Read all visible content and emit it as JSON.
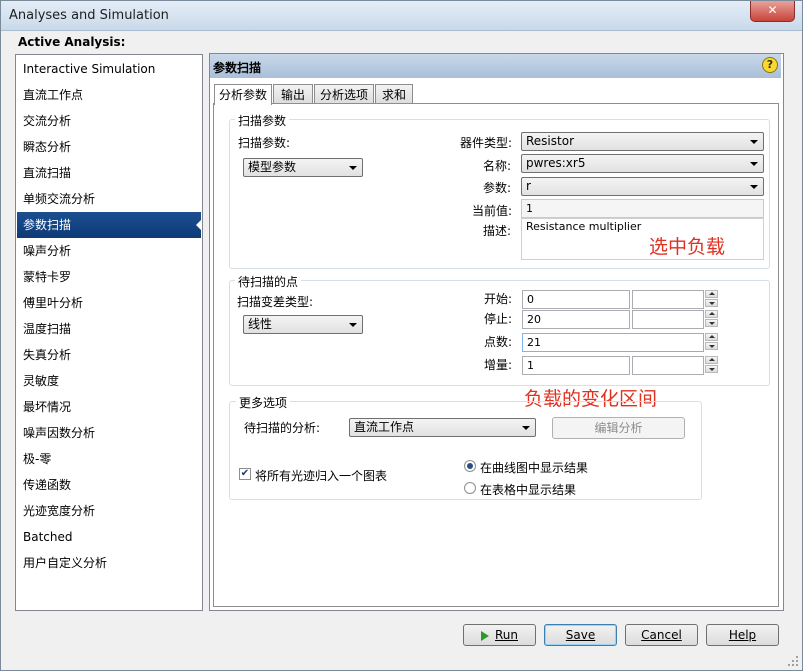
{
  "window": {
    "title": "Analyses and Simulation",
    "close_glyph": "✕"
  },
  "sidebar": {
    "header": "Active Analysis:",
    "selected_index": 6,
    "items": [
      "Interactive Simulation",
      "直流工作点",
      "交流分析",
      "瞬态分析",
      "直流扫描",
      "单频交流分析",
      "参数扫描",
      "噪声分析",
      "蒙特卡罗",
      "傅里叶分析",
      "温度扫描",
      "失真分析",
      "灵敏度",
      "最坏情况",
      "噪声因数分析",
      "极-零",
      "传递函数",
      "光迹宽度分析",
      "Batched",
      "用户自定义分析"
    ]
  },
  "panel": {
    "title": "参数扫描",
    "help_glyph": "?",
    "tabs": [
      "分析参数",
      "输出",
      "分析选项",
      "求和"
    ],
    "active_tab": 0
  },
  "sweep_params": {
    "group_title": "扫描参数",
    "sweep_param_label": "扫描参数:",
    "sweep_param_value": "模型参数",
    "device_type_label": "器件类型:",
    "device_type_value": "Resistor",
    "name_label": "名称:",
    "name_value": "pwres:xr5",
    "param_label": "参数:",
    "param_value": "r",
    "current_value_label": "当前值:",
    "current_value": "1",
    "description_label": "描述:",
    "description_value": "Resistance multiplier"
  },
  "points": {
    "group_title": "待扫描的点",
    "variation_type_label": "扫描变差类型:",
    "variation_type_value": "线性",
    "start_label": "开始:",
    "start_value": "0",
    "stop_label": "停止:",
    "stop_value": "20",
    "points_label": "点数:",
    "points_value": "21",
    "increment_label": "增量:",
    "increment_value": "1"
  },
  "more": {
    "group_title": "更多选项",
    "analysis_label": "待扫描的分析:",
    "analysis_value": "直流工作点",
    "edit_button": "编辑分析",
    "group_traces_label": "将所有光迹归入一个图表",
    "group_traces_checked": true,
    "check_glyph": "✔",
    "radio_graph_label": "在曲线图中显示结果",
    "radio_table_label": "在表格中显示结果",
    "radio_selected": "graph"
  },
  "annotations": {
    "select_load": "选中负载",
    "load_range": "负载的变化区间"
  },
  "footer": {
    "run": "Run",
    "save": "Save",
    "cancel": "Cancel",
    "help": "Help"
  },
  "colors": {
    "selection": "#0e3a76",
    "annotation": "#e03020",
    "header_bg": "#a9c0d9"
  }
}
